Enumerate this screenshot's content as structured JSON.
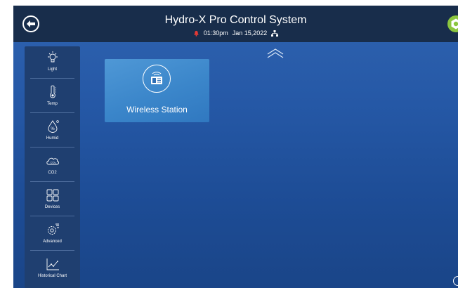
{
  "header": {
    "title": "Hydro-X Pro Control System",
    "time": "01:30pm",
    "date": "Jan 15,2022",
    "back_icon": "back-arrow-icon",
    "alarm_icon": "alarm-bell-icon",
    "network_icon": "network-icon",
    "settings_icon": "gear-icon"
  },
  "sidebar": {
    "items": [
      {
        "label": "Light",
        "icon": "light-bulb-icon"
      },
      {
        "label": "Temp",
        "icon": "thermometer-icon"
      },
      {
        "label": "Humid",
        "icon": "humidity-icon"
      },
      {
        "label": "CO2",
        "icon": "co2-cloud-icon"
      },
      {
        "label": "Devices",
        "icon": "devices-grid-icon"
      },
      {
        "label": "Advanced",
        "icon": "advanced-settings-icon"
      },
      {
        "label": "Historical Chart",
        "icon": "chart-icon"
      }
    ]
  },
  "main": {
    "cards": [
      {
        "label": "Wireless Station",
        "icon": "wireless-station-icon"
      }
    ],
    "collapse_icon": "double-chevron-up-icon"
  },
  "colors": {
    "header_bg": "#182d4b",
    "sidebar_bg": "#1f3f70",
    "card_bg": "#3b86ca",
    "alarm": "#e53935",
    "settings_accent": "#8bc63f"
  }
}
